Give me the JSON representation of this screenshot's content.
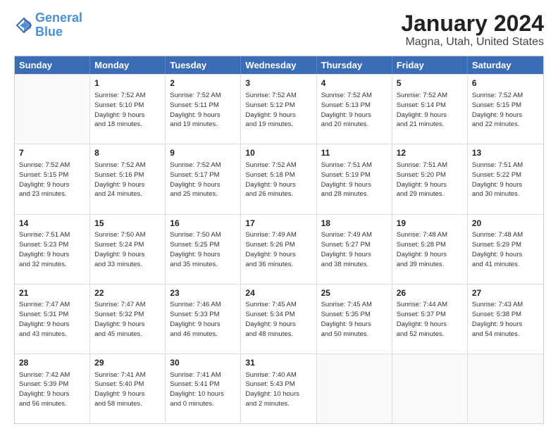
{
  "header": {
    "logo_line1": "General",
    "logo_line2": "Blue",
    "title": "January 2024",
    "subtitle": "Magna, Utah, United States"
  },
  "calendar": {
    "weekdays": [
      "Sunday",
      "Monday",
      "Tuesday",
      "Wednesday",
      "Thursday",
      "Friday",
      "Saturday"
    ],
    "rows": [
      [
        {
          "day": "",
          "text": ""
        },
        {
          "day": "1",
          "text": "Sunrise: 7:52 AM\nSunset: 5:10 PM\nDaylight: 9 hours\nand 18 minutes."
        },
        {
          "day": "2",
          "text": "Sunrise: 7:52 AM\nSunset: 5:11 PM\nDaylight: 9 hours\nand 19 minutes."
        },
        {
          "day": "3",
          "text": "Sunrise: 7:52 AM\nSunset: 5:12 PM\nDaylight: 9 hours\nand 19 minutes."
        },
        {
          "day": "4",
          "text": "Sunrise: 7:52 AM\nSunset: 5:13 PM\nDaylight: 9 hours\nand 20 minutes."
        },
        {
          "day": "5",
          "text": "Sunrise: 7:52 AM\nSunset: 5:14 PM\nDaylight: 9 hours\nand 21 minutes."
        },
        {
          "day": "6",
          "text": "Sunrise: 7:52 AM\nSunset: 5:15 PM\nDaylight: 9 hours\nand 22 minutes."
        }
      ],
      [
        {
          "day": "7",
          "text": "Sunrise: 7:52 AM\nSunset: 5:15 PM\nDaylight: 9 hours\nand 23 minutes."
        },
        {
          "day": "8",
          "text": "Sunrise: 7:52 AM\nSunset: 5:16 PM\nDaylight: 9 hours\nand 24 minutes."
        },
        {
          "day": "9",
          "text": "Sunrise: 7:52 AM\nSunset: 5:17 PM\nDaylight: 9 hours\nand 25 minutes."
        },
        {
          "day": "10",
          "text": "Sunrise: 7:52 AM\nSunset: 5:18 PM\nDaylight: 9 hours\nand 26 minutes."
        },
        {
          "day": "11",
          "text": "Sunrise: 7:51 AM\nSunset: 5:19 PM\nDaylight: 9 hours\nand 28 minutes."
        },
        {
          "day": "12",
          "text": "Sunrise: 7:51 AM\nSunset: 5:20 PM\nDaylight: 9 hours\nand 29 minutes."
        },
        {
          "day": "13",
          "text": "Sunrise: 7:51 AM\nSunset: 5:22 PM\nDaylight: 9 hours\nand 30 minutes."
        }
      ],
      [
        {
          "day": "14",
          "text": "Sunrise: 7:51 AM\nSunset: 5:23 PM\nDaylight: 9 hours\nand 32 minutes."
        },
        {
          "day": "15",
          "text": "Sunrise: 7:50 AM\nSunset: 5:24 PM\nDaylight: 9 hours\nand 33 minutes."
        },
        {
          "day": "16",
          "text": "Sunrise: 7:50 AM\nSunset: 5:25 PM\nDaylight: 9 hours\nand 35 minutes."
        },
        {
          "day": "17",
          "text": "Sunrise: 7:49 AM\nSunset: 5:26 PM\nDaylight: 9 hours\nand 36 minutes."
        },
        {
          "day": "18",
          "text": "Sunrise: 7:49 AM\nSunset: 5:27 PM\nDaylight: 9 hours\nand 38 minutes."
        },
        {
          "day": "19",
          "text": "Sunrise: 7:48 AM\nSunset: 5:28 PM\nDaylight: 9 hours\nand 39 minutes."
        },
        {
          "day": "20",
          "text": "Sunrise: 7:48 AM\nSunset: 5:29 PM\nDaylight: 9 hours\nand 41 minutes."
        }
      ],
      [
        {
          "day": "21",
          "text": "Sunrise: 7:47 AM\nSunset: 5:31 PM\nDaylight: 9 hours\nand 43 minutes."
        },
        {
          "day": "22",
          "text": "Sunrise: 7:47 AM\nSunset: 5:32 PM\nDaylight: 9 hours\nand 45 minutes."
        },
        {
          "day": "23",
          "text": "Sunrise: 7:46 AM\nSunset: 5:33 PM\nDaylight: 9 hours\nand 46 minutes."
        },
        {
          "day": "24",
          "text": "Sunrise: 7:45 AM\nSunset: 5:34 PM\nDaylight: 9 hours\nand 48 minutes."
        },
        {
          "day": "25",
          "text": "Sunrise: 7:45 AM\nSunset: 5:35 PM\nDaylight: 9 hours\nand 50 minutes."
        },
        {
          "day": "26",
          "text": "Sunrise: 7:44 AM\nSunset: 5:37 PM\nDaylight: 9 hours\nand 52 minutes."
        },
        {
          "day": "27",
          "text": "Sunrise: 7:43 AM\nSunset: 5:38 PM\nDaylight: 9 hours\nand 54 minutes."
        }
      ],
      [
        {
          "day": "28",
          "text": "Sunrise: 7:42 AM\nSunset: 5:39 PM\nDaylight: 9 hours\nand 56 minutes."
        },
        {
          "day": "29",
          "text": "Sunrise: 7:41 AM\nSunset: 5:40 PM\nDaylight: 9 hours\nand 58 minutes."
        },
        {
          "day": "30",
          "text": "Sunrise: 7:41 AM\nSunset: 5:41 PM\nDaylight: 10 hours\nand 0 minutes."
        },
        {
          "day": "31",
          "text": "Sunrise: 7:40 AM\nSunset: 5:43 PM\nDaylight: 10 hours\nand 2 minutes."
        },
        {
          "day": "",
          "text": ""
        },
        {
          "day": "",
          "text": ""
        },
        {
          "day": "",
          "text": ""
        }
      ]
    ]
  }
}
